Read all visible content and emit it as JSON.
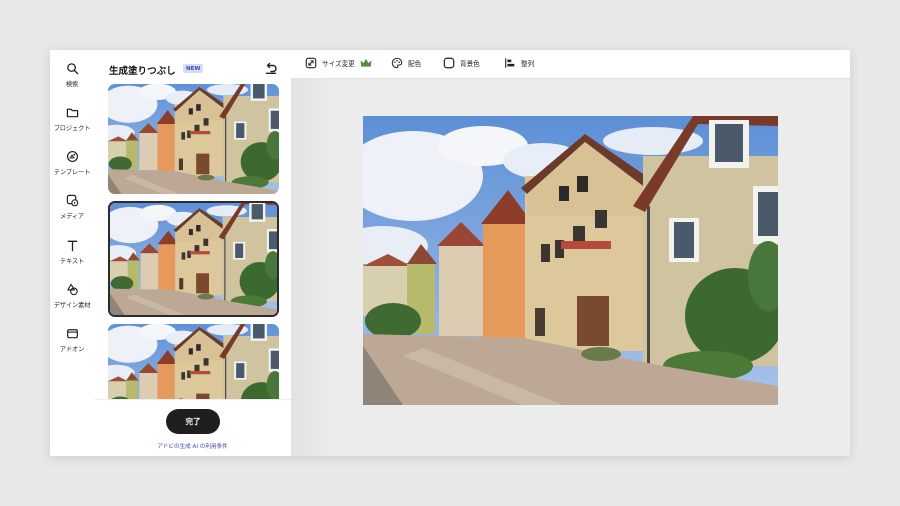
{
  "rail": {
    "items": [
      {
        "label": "検索",
        "icon": "search-icon"
      },
      {
        "label": "プロジェクト",
        "icon": "folder-icon"
      },
      {
        "label": "テンプレート",
        "icon": "template-icon"
      },
      {
        "label": "メディア",
        "icon": "media-icon"
      },
      {
        "label": "テキスト",
        "icon": "text-icon"
      },
      {
        "label": "デザイン素材",
        "icon": "shapes-icon"
      },
      {
        "label": "アドオン",
        "icon": "addon-icon"
      }
    ]
  },
  "panel": {
    "title": "生成塗りつぶし",
    "badge": "NEW",
    "done_label": "完了",
    "terms_link": "アドビの生成 AI の利用条件",
    "results": [
      {
        "selected": false
      },
      {
        "selected": true
      },
      {
        "selected": false
      }
    ]
  },
  "toolbar": {
    "items": [
      {
        "label": "サイズ変更",
        "icon": "resize-icon",
        "premium": true
      },
      {
        "label": "配色",
        "icon": "palette-icon"
      },
      {
        "label": "背景色",
        "icon": "background-color-icon"
      },
      {
        "label": "整列",
        "icon": "align-icon"
      }
    ]
  },
  "colors": {
    "accent": "#3b46b8",
    "badge_bg": "#d9dcf7",
    "done_button": "#1f1f1f",
    "premium": "#5a8a3a"
  }
}
